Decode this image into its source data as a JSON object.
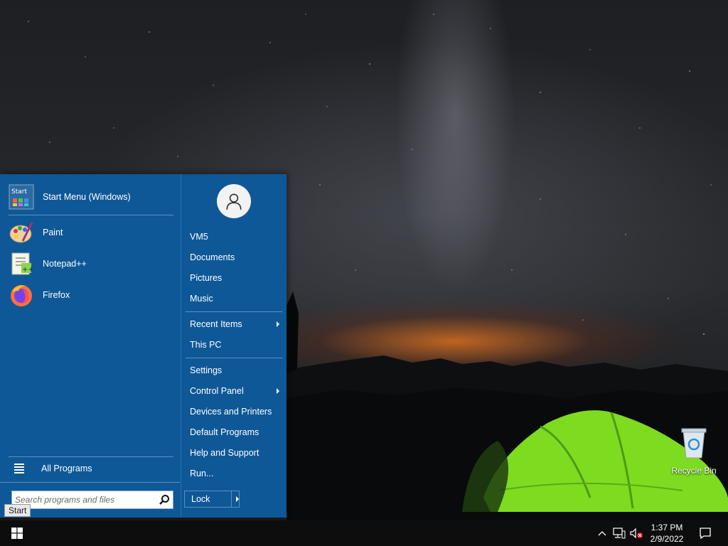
{
  "desktop": {
    "recycle_bin_label": "Recycle Bin",
    "recycle_bin_icon": "recycle-bin-icon"
  },
  "start_menu": {
    "header_item": {
      "label": "Start Menu (Windows)",
      "icon": "start-menu-app-icon"
    },
    "programs": [
      {
        "label": "Paint",
        "icon": "paint-palette-icon"
      },
      {
        "label": "Notepad++",
        "icon": "notepad-plus-plus-icon"
      },
      {
        "label": "Firefox",
        "icon": "firefox-icon"
      }
    ],
    "all_programs_label": "All Programs",
    "search_placeholder": "Search programs and files",
    "user_icon": "user-avatar-icon",
    "right_items": [
      {
        "label": "VM5",
        "submenu": false
      },
      {
        "label": "Documents",
        "submenu": false
      },
      {
        "label": "Pictures",
        "submenu": false
      },
      {
        "label": "Music",
        "submenu": false
      },
      {
        "label": "Recent Items",
        "submenu": true
      },
      {
        "label": "This PC",
        "submenu": false
      },
      {
        "label": "Settings",
        "submenu": false
      },
      {
        "label": "Control Panel",
        "submenu": true
      },
      {
        "label": "Devices and Printers",
        "submenu": false
      },
      {
        "label": "Default Programs",
        "submenu": false
      },
      {
        "label": "Help and Support",
        "submenu": false
      },
      {
        "label": "Run...",
        "submenu": false
      }
    ],
    "lock_label": "Lock"
  },
  "tooltip": {
    "text": "Start"
  },
  "taskbar": {
    "start_icon": "windows-logo-icon",
    "tray_icons": [
      "chevron-up-icon",
      "network-icon",
      "volume-muted-icon"
    ],
    "clock_time": "1:37 PM",
    "clock_date": "2/9/2022",
    "notification_icon": "action-center-icon"
  },
  "colors": {
    "start_menu_bg": "#0f5898",
    "taskbar_bg": "#0d0d0d",
    "tent_green": "#7ddc1f"
  }
}
